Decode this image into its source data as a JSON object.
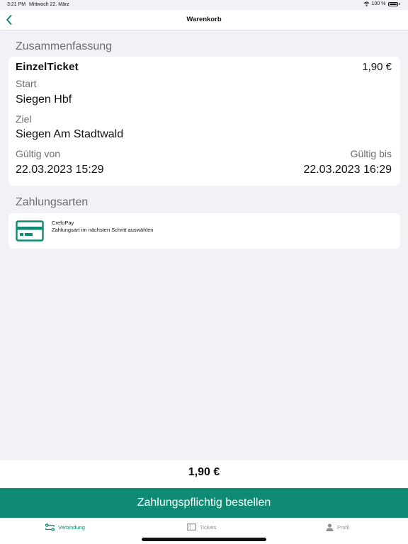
{
  "status": {
    "time": "3:21 PM",
    "date": "Mittwoch 22. März",
    "battery": "100 %"
  },
  "nav": {
    "title": "Warenkorb"
  },
  "summary": {
    "section_title": "Zusammenfassung",
    "ticket_name": "EinzelTicket",
    "price": "1,90 €",
    "start_label": "Start",
    "start_value": "Siegen Hbf",
    "destination_label": "Ziel",
    "destination_value": "Siegen Am Stadtwald",
    "valid_from_label": "Gültig von",
    "valid_from_value": "22.03.2023 15:29",
    "valid_until_label": "Gültig bis",
    "valid_until_value": "22.03.2023 16:29"
  },
  "payment": {
    "section_title": "Zahlungsarten",
    "provider": "CrefoPay",
    "description": "Zahlungsart im nächsten Schritt auswählen",
    "icon": "credit-card-icon"
  },
  "footer": {
    "total": "1,90 €",
    "order_button": "Zahlungspflichtig bestellen"
  },
  "tabs": [
    {
      "label": "Verbindung",
      "icon": "connection-icon",
      "active": true
    },
    {
      "label": "Tickets",
      "icon": "ticket-icon",
      "active": false
    },
    {
      "label": "Profil",
      "icon": "person-icon",
      "active": false
    }
  ],
  "colors": {
    "accent": "#0f8a74",
    "background": "#f2f2f6",
    "card": "#ffffff",
    "secondary_text": "#6d6d72"
  }
}
